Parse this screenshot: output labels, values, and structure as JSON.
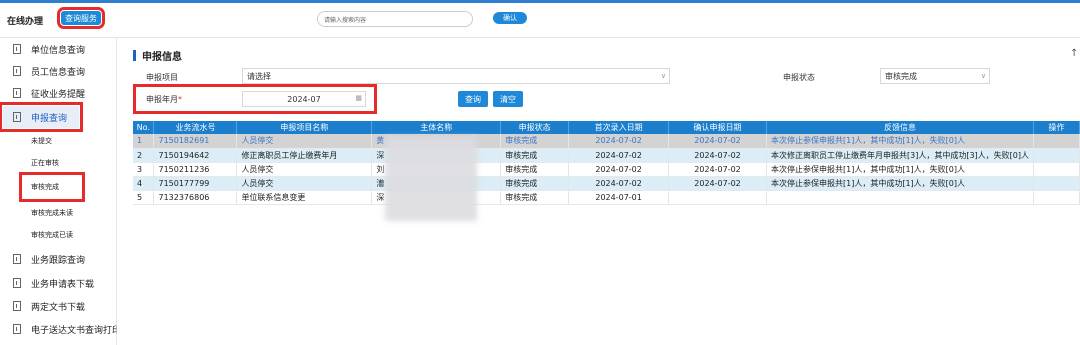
{
  "header": {
    "brand": "在线办理",
    "active_tab": "查询服务",
    "search_placeholder": "请输入搜索内容",
    "confirm": "确认"
  },
  "sidebar": {
    "items": [
      {
        "label": "单位信息查询"
      },
      {
        "label": "员工信息查询"
      },
      {
        "label": "征收业务提醒"
      },
      {
        "label": "申报查询"
      },
      {
        "label": "业务跟踪查询"
      },
      {
        "label": "业务申请表下载"
      },
      {
        "label": "两定文书下载"
      },
      {
        "label": "电子送达文书查询打印"
      }
    ],
    "subitems": [
      "未提交",
      "正在审核",
      "审核完成",
      "审核完成未读",
      "审核完成已读"
    ]
  },
  "panel": {
    "title": "申报信息",
    "up": "↑",
    "item_label": "申报项目",
    "item_value": "请选择",
    "status_label": "申报状态",
    "status_value": "审核完成",
    "month_label": "申报年月",
    "month_required": "*",
    "month_value": "2024-07",
    "query": "查询",
    "clear": "清空"
  },
  "table": {
    "headers": [
      "No.",
      "业务流水号",
      "申报项目名称",
      "主体名称",
      "申报状态",
      "首次录入日期",
      "确认申报日期",
      "反馈信息",
      "操作"
    ],
    "rows": [
      [
        "1",
        "7150182691",
        "人员停交",
        "黄",
        "审核完成",
        "2024-07-02",
        "2024-07-02",
        "本次停止参保申报共[1]人，其中成功[1]人，失败[0]人",
        ""
      ],
      [
        "2",
        "7150194642",
        "修正离职员工停止缴费年月",
        "深",
        "审核完成",
        "2024-07-02",
        "2024-07-02",
        "本次修正离职员工停止缴费年月申报共[3]人，其中成功[3]人，失败[0]人",
        ""
      ],
      [
        "3",
        "7150211236",
        "人员停交",
        "刘",
        "审核完成",
        "2024-07-02",
        "2024-07-02",
        "本次停止参保申报共[1]人，其中成功[1]人，失败[0]人",
        ""
      ],
      [
        "4",
        "7150177799",
        "人员停交",
        "漕",
        "审核完成",
        "2024-07-02",
        "2024-07-02",
        "本次停止参保申报共[1]人，其中成功[1]人，失败[0]人",
        ""
      ],
      [
        "5",
        "7132376806",
        "单位联系信息变更",
        "深",
        "审核完成",
        "2024-07-01",
        "",
        "",
        ""
      ]
    ]
  }
}
